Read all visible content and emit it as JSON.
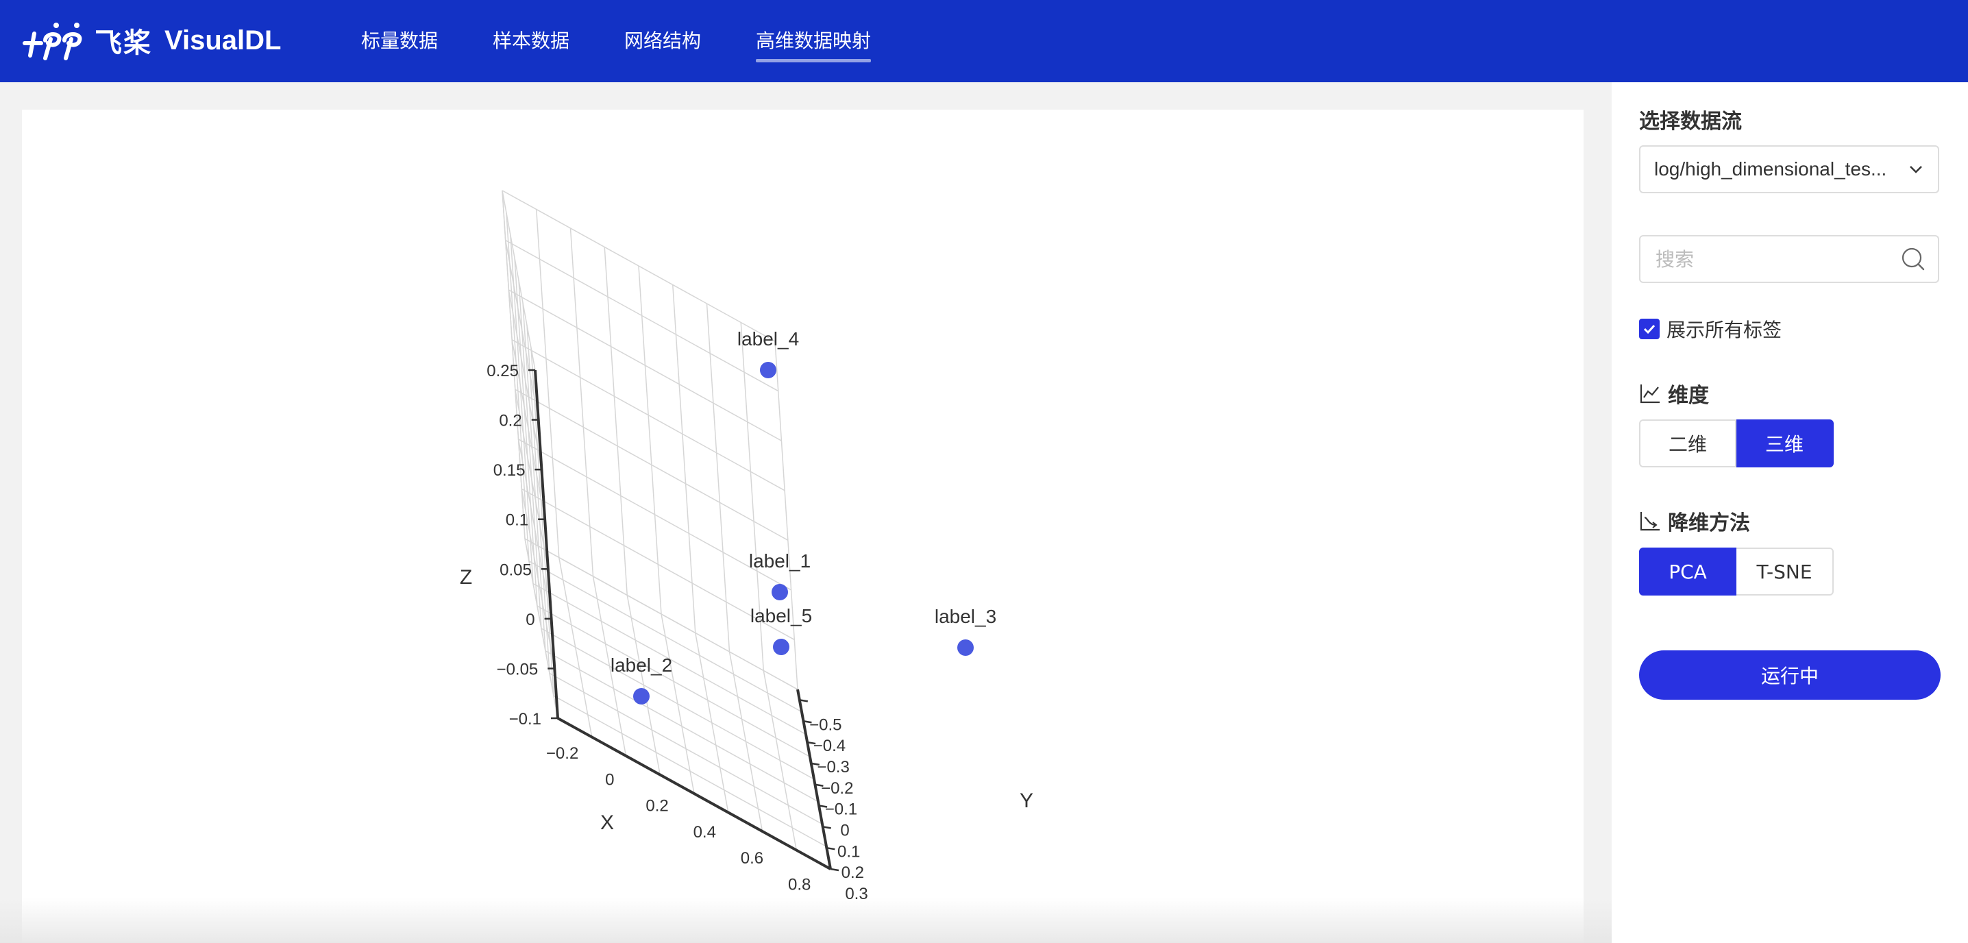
{
  "header": {
    "brand_cn": "飞桨",
    "brand_en": "VisualDL",
    "nav": [
      {
        "label": "标量数据",
        "active": false
      },
      {
        "label": "样本数据",
        "active": false
      },
      {
        "label": "网络结构",
        "active": false
      },
      {
        "label": "高维数据映射",
        "active": true
      }
    ]
  },
  "colors": {
    "header_bg": "#1332c5",
    "accent": "#2932e1",
    "point": "#4a5ae0"
  },
  "sidebar": {
    "stream_title": "选择数据流",
    "stream_value": "log/high_dimensional_tes...",
    "search_placeholder": "搜索",
    "show_all_labels": "展示所有标签",
    "dimension_title": "维度",
    "dimension_options": [
      "二维",
      "三维"
    ],
    "dimension_selected": "三维",
    "method_title": "降维方法",
    "method_options": [
      "PCA",
      "T-SNE"
    ],
    "method_selected": "PCA",
    "run_button": "运行中"
  },
  "chart_data": {
    "type": "scatter3d",
    "x_label": "X",
    "y_label": "Y",
    "z_label": "Z",
    "x_ticks": [
      "−0.2",
      "0",
      "0.2",
      "0.4",
      "0.6",
      "0.8"
    ],
    "y_ticks": [
      "−0.5",
      "−0.4",
      "−0.3",
      "−0.2",
      "−0.1",
      "0",
      "0.1",
      "0.2",
      "0.3"
    ],
    "z_ticks": [
      "−0.1",
      "−0.05",
      "0",
      "0.05",
      "0.1",
      "0.15",
      "0.2",
      "0.25"
    ],
    "x_range": [
      -0.3,
      0.85
    ],
    "y_range": [
      -0.55,
      0.3
    ],
    "z_range": [
      -0.1,
      0.25
    ],
    "points": [
      {
        "label": "label_1",
        "x": 0.2,
        "y": -0.1,
        "z": 0.05
      },
      {
        "label": "label_2",
        "x": 0.05,
        "y": -0.1,
        "z": -0.05
      },
      {
        "label": "label_3",
        "x": 0.6,
        "y": 0.1,
        "z": 0.0
      },
      {
        "label": "label_4",
        "x": 0.1,
        "y": 0.05,
        "z": 0.25
      },
      {
        "label": "label_5",
        "x": 0.2,
        "y": -0.1,
        "z": 0.0
      }
    ]
  }
}
